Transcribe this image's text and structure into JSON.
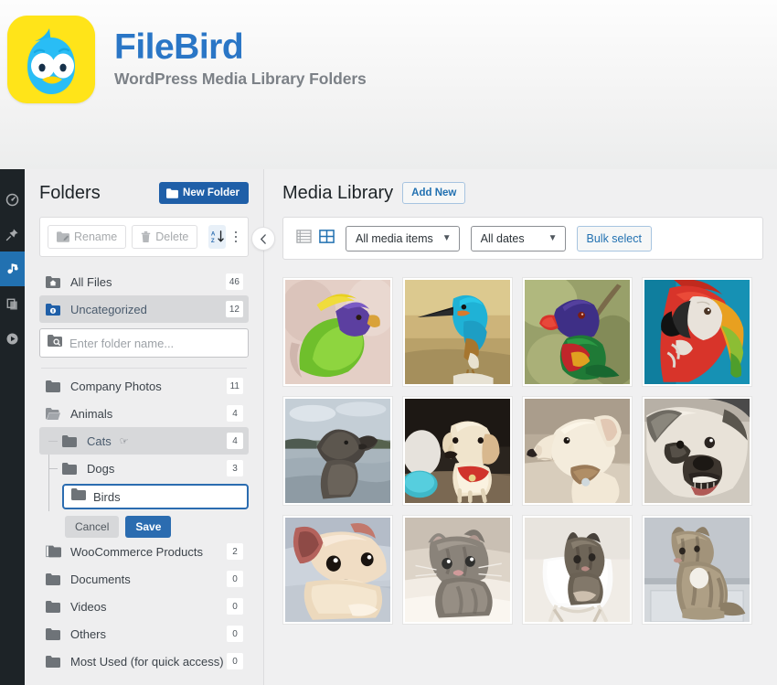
{
  "banner": {
    "logo_icon": "filebird-bird-logo",
    "title": "FileBird",
    "subtitle": "WordPress Media Library Folders",
    "colors": {
      "brand_blue": "#2a76c6",
      "logo_yellow": "#ffe419",
      "bird_blue": "#29b6f6"
    }
  },
  "wp_rail": {
    "items": [
      {
        "name": "dashboard",
        "icon": "dashboard-gauge-icon",
        "active": false
      },
      {
        "name": "posts",
        "icon": "pin-icon",
        "active": false
      },
      {
        "name": "media",
        "icon": "media-icon",
        "active": true
      },
      {
        "name": "pages",
        "icon": "pages-icon",
        "active": false
      },
      {
        "name": "comments",
        "icon": "play-circle-icon",
        "active": false
      }
    ]
  },
  "folders_panel": {
    "title": "Folders",
    "new_folder_label": "New Folder",
    "new_folder_icon": "folder-plus-icon",
    "collapse_icon": "chevron-left-icon",
    "toolbar": {
      "rename_label": "Rename",
      "rename_icon": "folder-pencil-icon",
      "delete_label": "Delete",
      "delete_icon": "trash-icon",
      "sort_icon": "sort-az-icon",
      "more_icon": "vertical-dots-icon"
    },
    "search": {
      "placeholder": "Enter folder name...",
      "icon": "folder-search-icon"
    },
    "top_items": [
      {
        "label": "All Files",
        "count": "46",
        "icon": "folder-home-icon",
        "selected": false
      },
      {
        "label": "Uncategorized",
        "count": "12",
        "icon": "folder-info-icon",
        "selected": true
      }
    ],
    "tree": [
      {
        "label": "Company Photos",
        "count": "11",
        "icon": "folder-icon",
        "depth": 0,
        "selected": false
      },
      {
        "label": "Animals",
        "count": "4",
        "icon": "folder-open-icon",
        "depth": 0,
        "selected": false
      },
      {
        "label": "Cats",
        "count": "4",
        "icon": "folder-icon",
        "depth": 1,
        "selected": true,
        "cursor": true
      },
      {
        "label": "Dogs",
        "count": "3",
        "icon": "folder-icon",
        "depth": 1,
        "selected": false
      }
    ],
    "editing": {
      "value": "Birds",
      "icon": "folder-icon",
      "cancel_label": "Cancel",
      "save_label": "Save"
    },
    "tree_after": [
      {
        "label": "WooCommerce Products",
        "count": "2",
        "icon": "folders-stack-icon",
        "depth": 0
      },
      {
        "label": "Documents",
        "count": "0",
        "icon": "folder-icon",
        "depth": 0
      },
      {
        "label": "Videos",
        "count": "0",
        "icon": "folder-icon",
        "depth": 0
      },
      {
        "label": "Others",
        "count": "0",
        "icon": "folder-icon",
        "depth": 0
      },
      {
        "label": "Most Used (for quick access)",
        "count": "0",
        "icon": "folder-icon",
        "depth": 0
      }
    ]
  },
  "media_library": {
    "title": "Media Library",
    "add_new_label": "Add New",
    "toolbar": {
      "list_view_icon": "list-view-icon",
      "grid_view_icon": "grid-view-icon",
      "media_filter_value": "All media items",
      "date_filter_value": "All dates",
      "bulk_select_label": "Bulk select"
    },
    "grid_items": [
      {
        "alt": "green-parrot",
        "row": 1,
        "col": 1
      },
      {
        "alt": "kingfisher",
        "row": 1,
        "col": 2
      },
      {
        "alt": "rainbow-lorikeet",
        "row": 1,
        "col": 3
      },
      {
        "alt": "scarlet-macaw",
        "row": 1,
        "col": 4
      },
      {
        "alt": "dog-by-water",
        "row": 2,
        "col": 1
      },
      {
        "alt": "golden-retriever-puppy",
        "row": 2,
        "col": 2
      },
      {
        "alt": "white-dog-profile",
        "row": 2,
        "col": 3
      },
      {
        "alt": "bulldog",
        "row": 2,
        "col": 4
      },
      {
        "alt": "sleeping-chihuahua",
        "row": 3,
        "col": 1
      },
      {
        "alt": "grey-kitten",
        "row": 3,
        "col": 2
      },
      {
        "alt": "kitten-on-chair",
        "row": 3,
        "col": 3
      },
      {
        "alt": "tabby-cat",
        "row": 3,
        "col": 4
      }
    ]
  }
}
